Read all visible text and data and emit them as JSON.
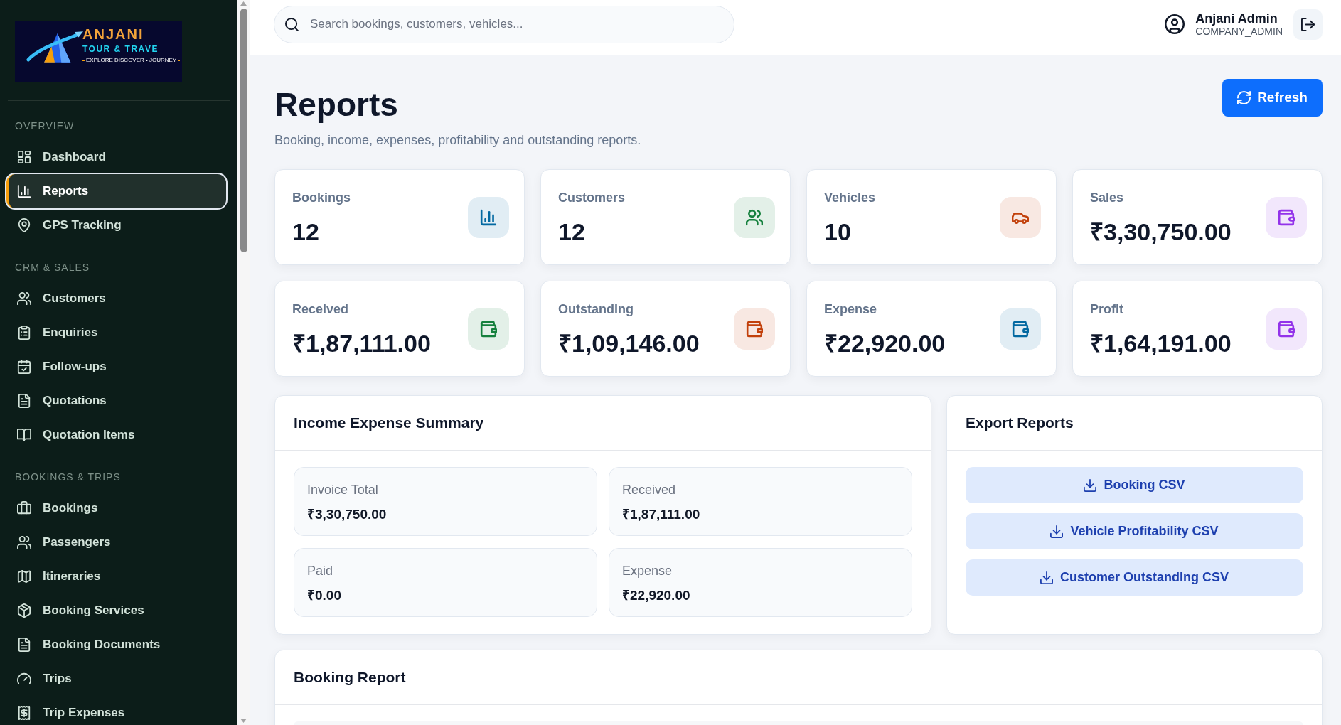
{
  "sidebar": {
    "logo": {
      "title": "ANJANI",
      "subtitle": "TOUR & TRAVE",
      "tagline": "EXPLORE DISCOVER • JOURNEY"
    },
    "sections": [
      {
        "label": "OVERVIEW",
        "items": [
          {
            "label": "Dashboard",
            "kind": "dashboard",
            "selected": false
          },
          {
            "label": "Reports",
            "kind": "chart",
            "selected": true
          },
          {
            "label": "GPS Tracking",
            "kind": "pin",
            "selected": false
          }
        ]
      },
      {
        "label": "CRM & SALES",
        "items": [
          {
            "label": "Customers",
            "kind": "users",
            "selected": false
          },
          {
            "label": "Enquiries",
            "kind": "clipboard",
            "selected": false
          },
          {
            "label": "Follow-ups",
            "kind": "calendar",
            "selected": false
          },
          {
            "label": "Quotations",
            "kind": "file",
            "selected": false
          },
          {
            "label": "Quotation Items",
            "kind": "book",
            "selected": false
          }
        ]
      },
      {
        "label": "BOOKINGS & TRIPS",
        "items": [
          {
            "label": "Bookings",
            "kind": "briefcase",
            "selected": false
          },
          {
            "label": "Passengers",
            "kind": "users",
            "selected": false
          },
          {
            "label": "Itineraries",
            "kind": "map",
            "selected": false
          },
          {
            "label": "Booking Services",
            "kind": "package",
            "selected": false
          },
          {
            "label": "Booking Documents",
            "kind": "file",
            "selected": false
          },
          {
            "label": "Trips",
            "kind": "gauge",
            "selected": false
          },
          {
            "label": "Trip Expenses",
            "kind": "receipt",
            "selected": false
          }
        ]
      }
    ]
  },
  "topbar": {
    "search": {
      "placeholder": "Search bookings, customers, vehicles..."
    },
    "user": {
      "name": "Anjani Admin",
      "role": "COMPANY_ADMIN"
    }
  },
  "header": {
    "title": "Reports",
    "subtitle": "Booking, income, expenses, profitability and outstanding reports.",
    "refresh_button": "Refresh"
  },
  "stats": [
    {
      "label": "Bookings",
      "value": "12",
      "kind": "chart",
      "color": "#0369a1"
    },
    {
      "label": "Customers",
      "value": "12",
      "kind": "users",
      "color": "#15803d"
    },
    {
      "label": "Vehicles",
      "value": "10",
      "kind": "car",
      "color": "#c2410c"
    },
    {
      "label": "Sales",
      "value": "₹3,30,750.00",
      "kind": "wallet",
      "color": "#9333ea"
    },
    {
      "label": "Received",
      "value": "₹1,87,111.00",
      "kind": "wallet",
      "color": "#15803d"
    },
    {
      "label": "Outstanding",
      "value": "₹1,09,146.00",
      "kind": "wallet",
      "color": "#c2410c"
    },
    {
      "label": "Expense",
      "value": "₹22,920.00",
      "kind": "wallet",
      "color": "#0369a1"
    },
    {
      "label": "Profit",
      "value": "₹1,64,191.00",
      "kind": "wallet",
      "color": "#9333ea"
    }
  ],
  "income_expense_summary": {
    "title": "Income Expense Summary",
    "items": [
      {
        "label": "Invoice Total",
        "value": "₹3,30,750.00"
      },
      {
        "label": "Received",
        "value": "₹1,87,111.00"
      },
      {
        "label": "Paid",
        "value": "₹0.00"
      },
      {
        "label": "Expense",
        "value": "₹22,920.00"
      }
    ]
  },
  "export_reports": {
    "title": "Export Reports",
    "buttons": [
      "Booking CSV",
      "Vehicle Profitability CSV",
      "Customer Outstanding CSV"
    ]
  },
  "booking_report": {
    "title": "Booking Report"
  }
}
